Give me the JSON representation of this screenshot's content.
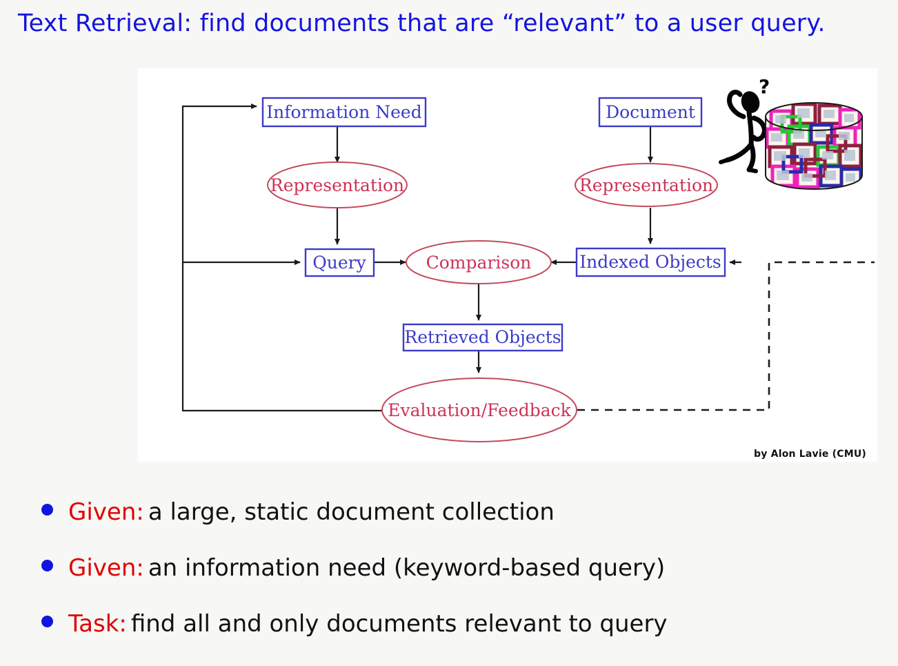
{
  "slide": {
    "title": "Text Retrieval: find documents that are “relevant” to a user query.",
    "background_color": "#f7f7f5",
    "title_color": "#1414e0"
  },
  "figure": {
    "credit": "by Alon Lavie (CMU)",
    "background_color": "#ffffff",
    "box_color": "#3b3bc8",
    "ellipse_color": "#c24a5c",
    "arrow_color": "#1a1a1a",
    "nodes": [
      {
        "id": "information-need",
        "label": "Information Need",
        "shape": "box"
      },
      {
        "id": "representation-query",
        "label": "Representation",
        "shape": "ellipse"
      },
      {
        "id": "query",
        "label": "Query",
        "shape": "box"
      },
      {
        "id": "comparison",
        "label": "Comparison",
        "shape": "ellipse"
      },
      {
        "id": "document",
        "label": "Document",
        "shape": "box"
      },
      {
        "id": "representation-document",
        "label": "Representation",
        "shape": "ellipse"
      },
      {
        "id": "indexed-objects",
        "label": "Indexed Objects",
        "shape": "box"
      },
      {
        "id": "retrieved-objects",
        "label": "Retrieved Objects",
        "shape": "box"
      },
      {
        "id": "evaluation-feedback",
        "label": "Evaluation/Feedback",
        "shape": "ellipse"
      }
    ],
    "illustrations": [
      {
        "id": "thinking-person",
        "label": "stick figure scratching head with question mark"
      },
      {
        "id": "document-database",
        "label": "cylinder database filled with colored document icons"
      }
    ]
  },
  "bullets": [
    {
      "label": "Given:",
      "text": "a large, static document collection"
    },
    {
      "label": "Given:",
      "text": "an information need (keyword-based query)"
    },
    {
      "label": "Task:",
      "text": "find all and only documents relevant to query"
    }
  ]
}
